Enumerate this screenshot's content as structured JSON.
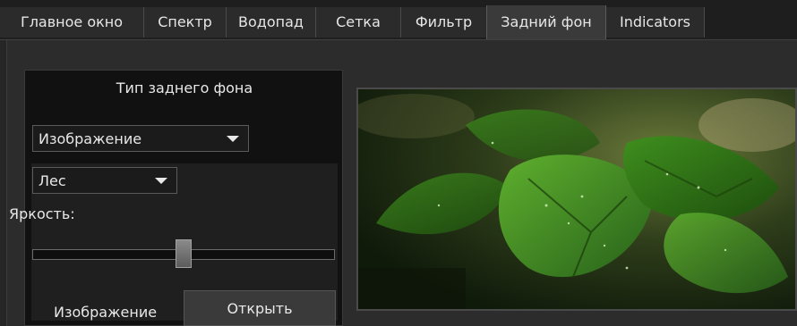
{
  "tabs": [
    {
      "label": "Главное окно"
    },
    {
      "label": "Спектр"
    },
    {
      "label": "Водопад"
    },
    {
      "label": "Сетка"
    },
    {
      "label": "Фильтр"
    },
    {
      "label": "Задний фон",
      "active": true
    },
    {
      "label": "Indicators"
    }
  ],
  "panel": {
    "title": "Тип заднего фона",
    "type_select": {
      "value": "Изображение"
    },
    "preset_select": {
      "value": "Лес"
    },
    "brightness_label": "Яркость:",
    "brightness_value": 0.5,
    "image_label": "Изображение",
    "open_button": "Открыть"
  },
  "icons": {
    "dropdown": "chevron-down-icon"
  }
}
